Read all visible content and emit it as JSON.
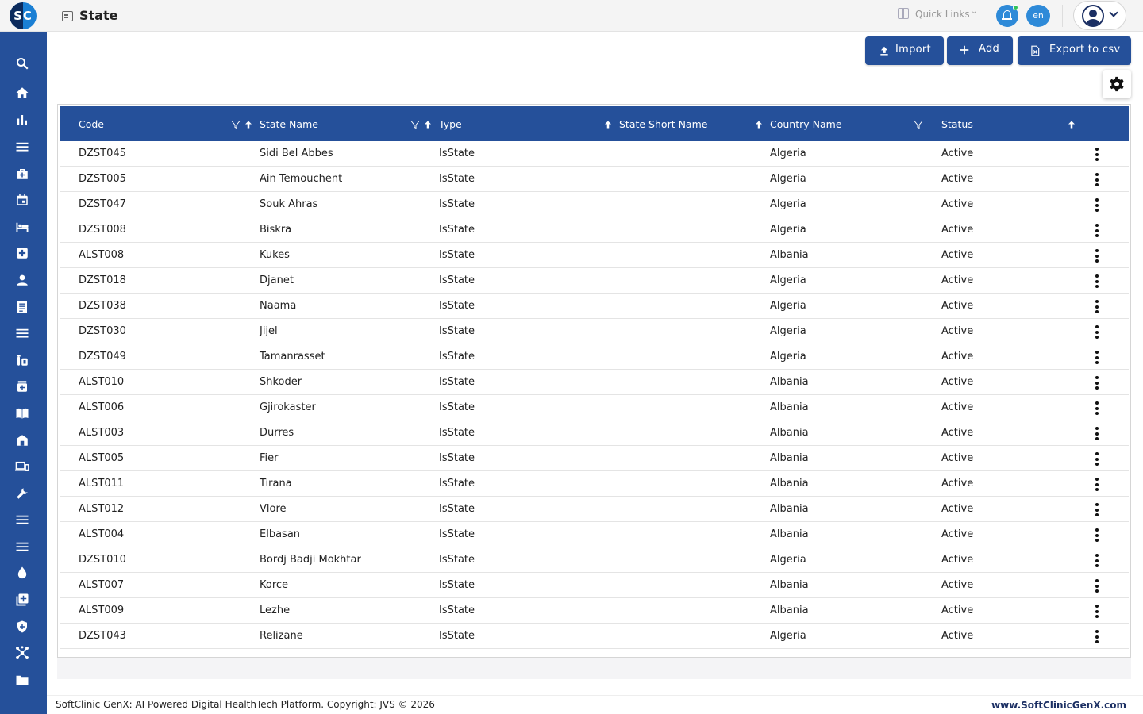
{
  "header": {
    "logo_text": "SC",
    "page_title": "State",
    "quick_links_label": "Quick Links",
    "language": "en"
  },
  "toolbar": {
    "import_label": "Import",
    "add_label": "Add",
    "export_label": "Export to csv"
  },
  "grid": {
    "columns": [
      "Code",
      "State Name",
      "Type",
      "State Short Name",
      "Country Name",
      "Status"
    ],
    "rows": [
      [
        "DZST045",
        "Sidi Bel Abbes",
        "IsState",
        "",
        "Algeria",
        "Active"
      ],
      [
        "DZST005",
        "Ain Temouchent",
        "IsState",
        "",
        "Algeria",
        "Active"
      ],
      [
        "DZST047",
        "Souk Ahras",
        "IsState",
        "",
        "Algeria",
        "Active"
      ],
      [
        "DZST008",
        "Biskra",
        "IsState",
        "",
        "Algeria",
        "Active"
      ],
      [
        "ALST008",
        "Kukes",
        "IsState",
        "",
        "Albania",
        "Active"
      ],
      [
        "DZST018",
        "Djanet",
        "IsState",
        "",
        "Algeria",
        "Active"
      ],
      [
        "DZST038",
        "Naama",
        "IsState",
        "",
        "Algeria",
        "Active"
      ],
      [
        "DZST030",
        "Jijel",
        "IsState",
        "",
        "Algeria",
        "Active"
      ],
      [
        "DZST049",
        "Tamanrasset",
        "IsState",
        "",
        "Algeria",
        "Active"
      ],
      [
        "ALST010",
        "Shkoder",
        "IsState",
        "",
        "Albania",
        "Active"
      ],
      [
        "ALST006",
        "Gjirokaster",
        "IsState",
        "",
        "Albania",
        "Active"
      ],
      [
        "ALST003",
        "Durres",
        "IsState",
        "",
        "Albania",
        "Active"
      ],
      [
        "ALST005",
        "Fier",
        "IsState",
        "",
        "Albania",
        "Active"
      ],
      [
        "ALST011",
        "Tirana",
        "IsState",
        "",
        "Albania",
        "Active"
      ],
      [
        "ALST012",
        "Vlore",
        "IsState",
        "",
        "Albania",
        "Active"
      ],
      [
        "ALST004",
        "Elbasan",
        "IsState",
        "",
        "Albania",
        "Active"
      ],
      [
        "DZST010",
        "Bordj Badji Mokhtar",
        "IsState",
        "",
        "Algeria",
        "Active"
      ],
      [
        "ALST007",
        "Korce",
        "IsState",
        "",
        "Albania",
        "Active"
      ],
      [
        "ALST009",
        "Lezhe",
        "IsState",
        "",
        "Albania",
        "Active"
      ],
      [
        "DZST043",
        "Relizane",
        "IsState",
        "",
        "Algeria",
        "Active"
      ]
    ]
  },
  "sidebar": {
    "icons": [
      "search-icon",
      "home-icon",
      "bar-chart-icon",
      "menu-icon",
      "medical-bag-icon",
      "calendar-icon",
      "bed-icon",
      "medical-cross-icon",
      "person-icon",
      "receipt-icon",
      "list-icon",
      "lab-icon",
      "pharmacy-icon",
      "book-icon",
      "building-icon",
      "devices-icon",
      "wrench-icon",
      "list-icon",
      "list-icon",
      "drop-icon",
      "add-box-icon",
      "shield-icon",
      "network-icon",
      "folder-icon"
    ]
  },
  "footer": {
    "copyright": "SoftClinic GenX: AI Powered Digital HealthTech Platform. Copyright: JVS © 2026",
    "website": "www.SoftClinicGenX.com"
  },
  "colors": {
    "primary": "#25509a",
    "accent": "#2e8ad8",
    "online_dot": "#33c35a"
  }
}
